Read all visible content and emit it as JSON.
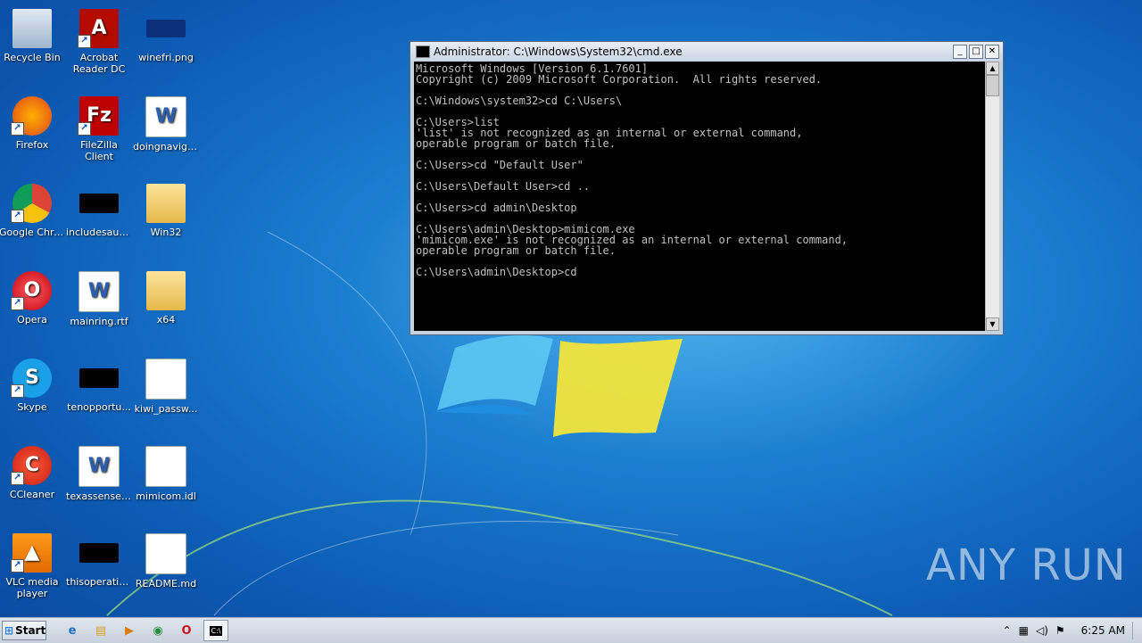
{
  "desktop": {
    "icons": [
      {
        "label": "Recycle Bin"
      },
      {
        "label": "Acrobat Reader DC"
      },
      {
        "label": "winefri.png"
      },
      {
        "label": "Firefox"
      },
      {
        "label": "FileZilla Client"
      },
      {
        "label": "doingnaviga..."
      },
      {
        "label": "Google Chrome"
      },
      {
        "label": "includesaut..."
      },
      {
        "label": "Win32"
      },
      {
        "label": "Opera"
      },
      {
        "label": "mainring.rtf"
      },
      {
        "label": "x64"
      },
      {
        "label": "Skype"
      },
      {
        "label": "tenopportu..."
      },
      {
        "label": "kiwi_passw..."
      },
      {
        "label": "CCleaner"
      },
      {
        "label": "texassense.rtf"
      },
      {
        "label": "mimicom.idl"
      },
      {
        "label": "VLC media player"
      },
      {
        "label": "thisoperatio..."
      },
      {
        "label": "README.md"
      }
    ]
  },
  "cmd_window": {
    "title": "Administrator: C:\\Windows\\System32\\cmd.exe",
    "lines": [
      "Microsoft Windows [Version 6.1.7601]",
      "Copyright (c) 2009 Microsoft Corporation.  All rights reserved.",
      "",
      "C:\\Windows\\system32>cd C:\\Users\\",
      "",
      "C:\\Users>list",
      "'list' is not recognized as an internal or external command,",
      "operable program or batch file.",
      "",
      "C:\\Users>cd \"Default User\"",
      "",
      "C:\\Users\\Default User>cd ..",
      "",
      "C:\\Users>cd admin\\Desktop",
      "",
      "C:\\Users\\admin\\Desktop>mimicom.exe",
      "'mimicom.exe' is not recognized as an internal or external command,",
      "operable program or batch file.",
      "",
      "C:\\Users\\admin\\Desktop>cd"
    ]
  },
  "taskbar": {
    "start_label": "Start",
    "clock": "6:25 AM"
  },
  "watermark": "ANY RUN"
}
